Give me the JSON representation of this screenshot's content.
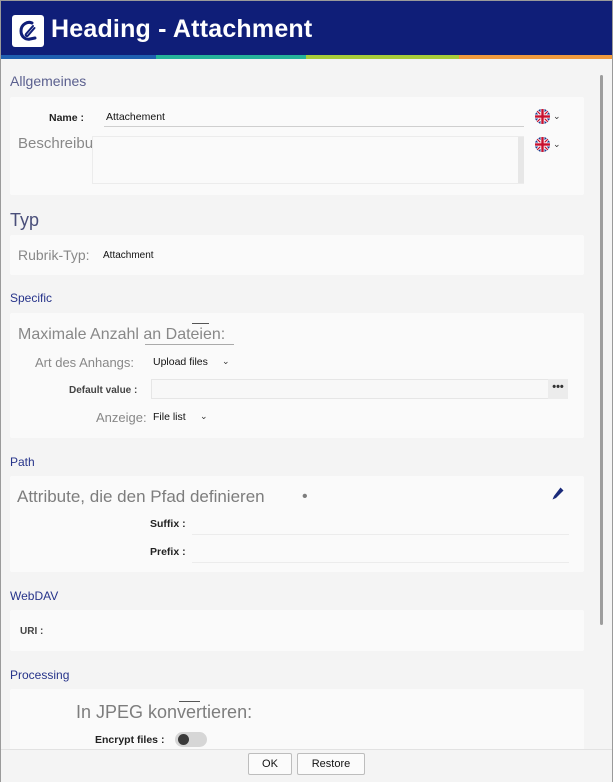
{
  "window": {
    "title": "Heading - Attachment"
  },
  "colors": {
    "titlebar": "#0f1e78",
    "stripe": [
      "#1f5fb0",
      "#25b39a",
      "#a8cc3a",
      "#f09a3e"
    ],
    "section": "#26338a"
  },
  "general": {
    "heading": "Allgemeines",
    "name_label": "Name :",
    "name_value": "Attachement",
    "description_label": "Beschreibung:",
    "language_icon": "uk-flag-icon"
  },
  "typ": {
    "heading": "Typ",
    "rubric_type_label": "Rubrik-Typ:",
    "rubric_type_value": "Attachment"
  },
  "specific": {
    "heading": "Specific",
    "max_files_label": "Maximale Anzahl an Dateien:",
    "attachment_type_label": "Art des Anhangs:",
    "attachment_type_value": "Upload files",
    "default_value_label": "Default value :",
    "default_value_button": "•••",
    "display_label": "Anzeige:",
    "display_value": "File list"
  },
  "path": {
    "heading": "Path",
    "attributes_label": "Attribute, die den Pfad definieren",
    "required_marker": "•",
    "suffix_label": "Suffix :",
    "prefix_label": "Prefix :"
  },
  "webdav": {
    "heading": "WebDAV",
    "uri_label": "URI :"
  },
  "processing": {
    "heading": "Processing",
    "jpeg_label": "In JPEG konvertieren:",
    "encrypt_label": "Encrypt files :",
    "encrypt_on": false
  },
  "footer": {
    "ok_label": "OK",
    "restore_label": "Restore"
  }
}
